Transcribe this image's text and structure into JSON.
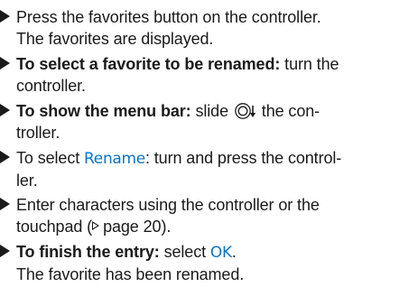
{
  "steps": [
    {
      "text": "Press the favorites button on the controller.",
      "result": "The favorites are displayed."
    },
    {
      "bold": "To select a favorite to be renamed:",
      "text": " turn the",
      "line2": "controller."
    },
    {
      "bold": "To show the menu bar:",
      "text_before": " slide ",
      "text_after": " the con-",
      "line2": "troller."
    },
    {
      "text_before": "To select ",
      "highlight": "Rename",
      "text_after": ": turn and press the control-",
      "line2": "ler."
    },
    {
      "text": "Enter characters using the controller or the",
      "line2_before": "touchpad (",
      "line2_page": "page 20",
      "line2_after": ")."
    },
    {
      "bold": "To finish the entry:",
      "text_before": " select ",
      "highlight": "OK",
      "text_after": ".",
      "result": "The favorite has been renamed."
    }
  ],
  "icons": {
    "step_marker": "triangle-right-icon",
    "controller_slide": "controller-slide-down-icon",
    "page_reference": "page-reference-triangle-icon"
  },
  "colors": {
    "text": "#1a1a1a",
    "highlight": "#0b74c5"
  }
}
